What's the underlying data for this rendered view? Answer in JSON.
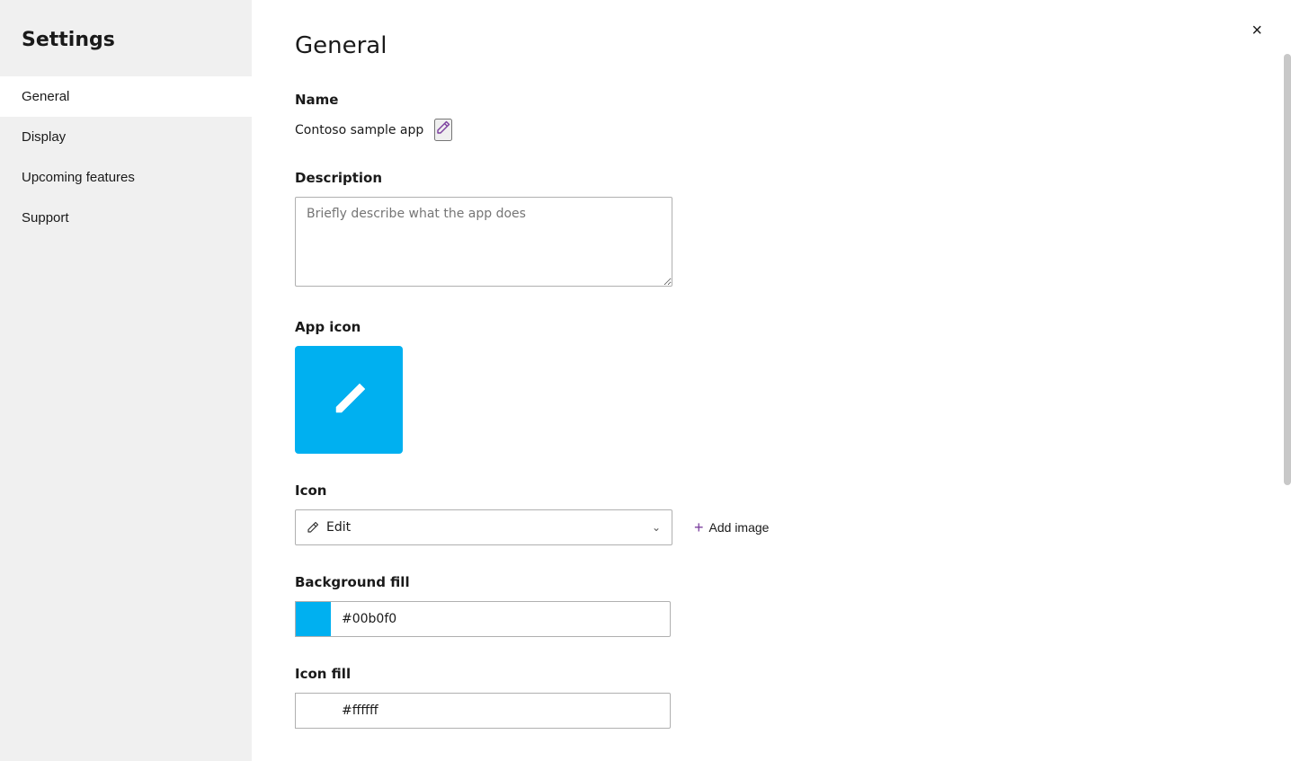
{
  "sidebar": {
    "title": "Settings",
    "items": [
      {
        "label": "General",
        "active": true
      },
      {
        "label": "Display",
        "active": false
      },
      {
        "label": "Upcoming features",
        "active": false
      },
      {
        "label": "Support",
        "active": false
      }
    ]
  },
  "main": {
    "title": "General",
    "close_label": "×",
    "sections": {
      "name": {
        "label": "Name",
        "value": "Contoso sample app",
        "edit_icon": "✏"
      },
      "description": {
        "label": "Description",
        "placeholder": "Briefly describe what the app does"
      },
      "app_icon": {
        "label": "App icon",
        "bg_color": "#00b0f0"
      },
      "icon": {
        "label": "Icon",
        "selected": "Edit",
        "add_image_label": "Add image"
      },
      "background_fill": {
        "label": "Background fill",
        "color": "#00b0f0",
        "value": "#00b0f0"
      },
      "icon_fill": {
        "label": "Icon fill",
        "color": "#ffffff",
        "value": "#ffffff"
      }
    }
  }
}
